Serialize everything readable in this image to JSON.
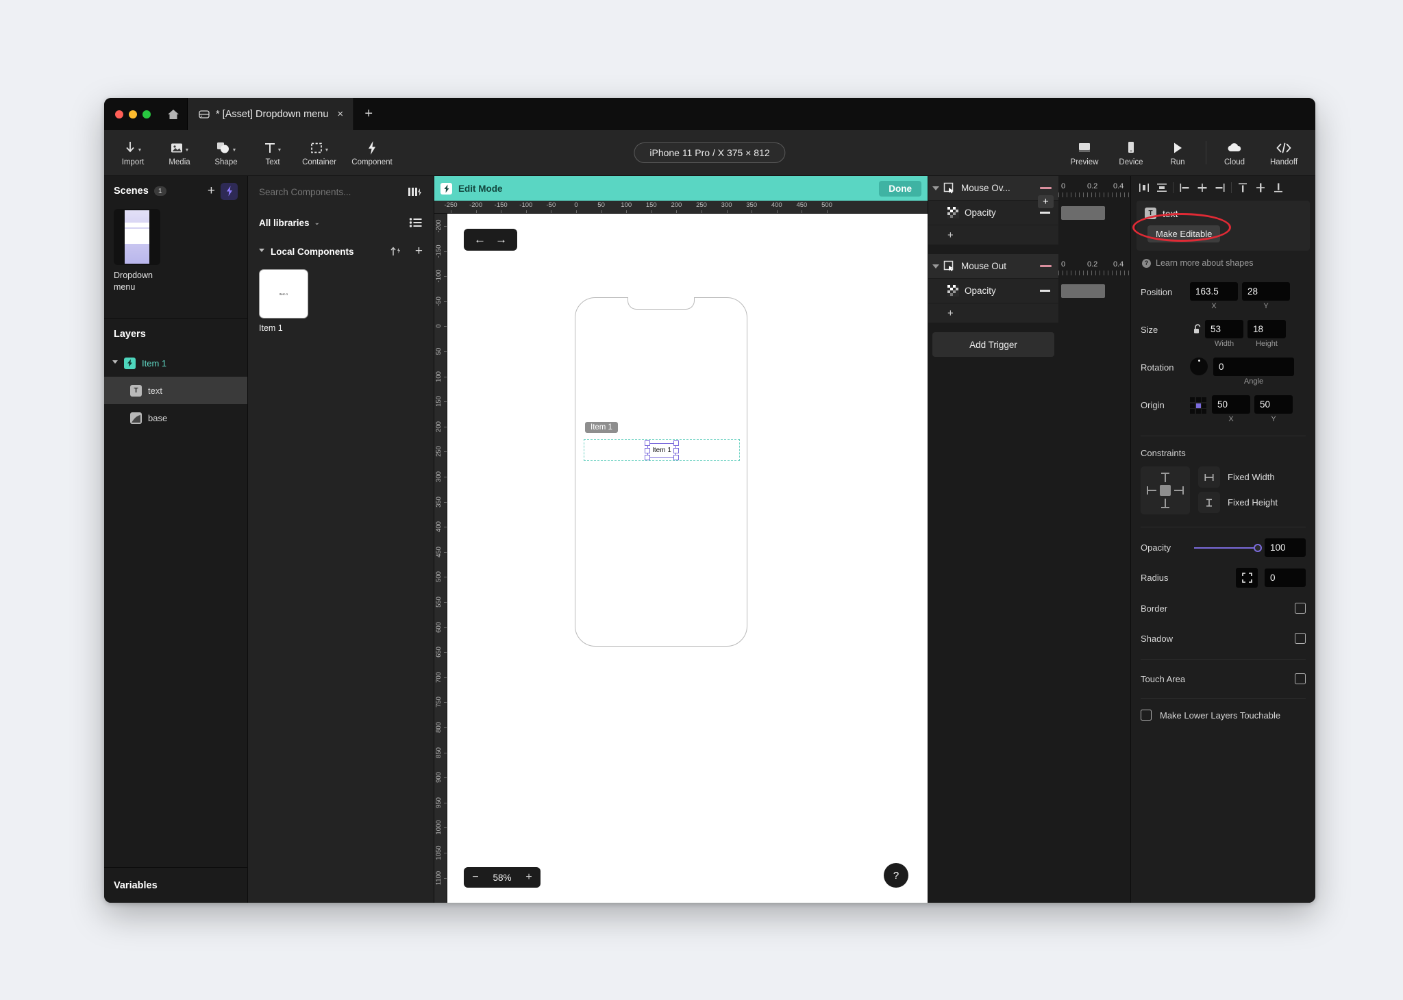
{
  "titlebar": {
    "home_label": "home-button",
    "tab_title": "* [Asset] Dropdown menu",
    "tab_close": "×",
    "new_tab": "+"
  },
  "toolbar": {
    "left_tools": [
      {
        "label": "Import",
        "icon": "download-arrow-icon",
        "has_caret": true
      },
      {
        "label": "Media",
        "icon": "image-icon",
        "has_caret": true
      },
      {
        "label": "Shape",
        "icon": "shape-icon",
        "has_caret": true
      },
      {
        "label": "Text",
        "icon": "text-t-icon",
        "has_caret": true
      },
      {
        "label": "Container",
        "icon": "dashed-square-icon",
        "has_caret": true
      },
      {
        "label": "Component",
        "icon": "lightning-bolt-icon",
        "has_caret": false
      }
    ],
    "device_pill": "iPhone 11 Pro / X  375 × 812",
    "right_tools": [
      {
        "label": "Preview",
        "icon": "monitor-icon"
      },
      {
        "label": "Device",
        "icon": "phone-icon"
      },
      {
        "label": "Run",
        "icon": "play-triangle-icon"
      },
      {
        "label": "Cloud",
        "icon": "cloud-icon"
      },
      {
        "label": "Handoff",
        "icon": "code-brackets-icon"
      }
    ]
  },
  "scenes": {
    "title": "Scenes",
    "count": "1",
    "add_label": "+",
    "items": [
      {
        "name": "Dropdown\nmenu",
        "display_name": "Dropdown menu"
      }
    ]
  },
  "layers": {
    "title": "Layers",
    "items": [
      {
        "label": "Item 1",
        "icon": "component-icon",
        "depth": 0,
        "selected": false,
        "expanded": true
      },
      {
        "label": "text",
        "icon": "text-layer-icon",
        "depth": 1,
        "selected": true
      },
      {
        "label": "base",
        "icon": "shape-layer-icon",
        "depth": 1,
        "selected": false
      }
    ]
  },
  "variables": {
    "title": "Variables"
  },
  "components": {
    "search_placeholder": "Search Components...",
    "libraries_label": "All libraries",
    "section_label": "Local Components",
    "items": [
      {
        "name": "Item 1",
        "thumb_text": "Item 1"
      }
    ]
  },
  "canvas": {
    "edit_mode_label": "Edit Mode",
    "done_label": "Done",
    "zoom_value": "58%",
    "zoom_minus": "−",
    "zoom_plus": "+",
    "nav_back": "←",
    "nav_forward": "→",
    "help_label": "?",
    "selected_badge": "Item 1",
    "selected_text": "Item 1",
    "ruler_h": [
      "-250",
      "-200",
      "-150",
      "-100",
      "-50",
      "0",
      "50",
      "100",
      "150",
      "200",
      "250",
      "300",
      "350",
      "400",
      "450",
      "500"
    ],
    "ruler_v": [
      "-200",
      "-150",
      "-100",
      "-50",
      "0",
      "50",
      "100",
      "150",
      "200",
      "250",
      "300",
      "350",
      "400",
      "450",
      "500",
      "550",
      "600",
      "650",
      "700",
      "750",
      "800",
      "850",
      "900",
      "950",
      "1000",
      "1050",
      "1100"
    ]
  },
  "triggers": {
    "add_trigger_label": "Add Trigger",
    "plus_label": "+",
    "blocks": [
      {
        "name": "Mouse Ov...",
        "full_name": "Mouse Over",
        "icon": "mouse-over-icon",
        "scale": [
          "0",
          "0.2",
          "0.4"
        ],
        "props": [
          {
            "name": "Opacity",
            "icon": "opacity-checker-icon"
          }
        ],
        "add_label": "+"
      },
      {
        "name": "Mouse Out",
        "full_name": "Mouse Out",
        "icon": "mouse-out-icon",
        "scale": [
          "0",
          "0.2",
          "0.4"
        ],
        "props": [
          {
            "name": "Opacity",
            "icon": "opacity-checker-icon"
          }
        ],
        "add_label": "+"
      }
    ]
  },
  "properties": {
    "layer_name": "text",
    "make_editable_label": "Make Editable",
    "learn_more_label": "Learn more about shapes",
    "position": {
      "label": "Position",
      "x": "163.5",
      "y": "28",
      "x_sub": "X",
      "y_sub": "Y"
    },
    "size": {
      "label": "Size",
      "width": "53",
      "height": "18",
      "w_sub": "Width",
      "h_sub": "Height"
    },
    "rotation": {
      "label": "Rotation",
      "angle": "0",
      "sub": "Angle"
    },
    "origin": {
      "label": "Origin",
      "x": "50",
      "y": "50",
      "x_sub": "X",
      "y_sub": "Y"
    },
    "constraints": {
      "label": "Constraints",
      "fixed_width": "Fixed Width",
      "fixed_height": "Fixed Height"
    },
    "opacity": {
      "label": "Opacity",
      "value": "100"
    },
    "radius": {
      "label": "Radius",
      "value": "0"
    },
    "border": {
      "label": "Border"
    },
    "shadow": {
      "label": "Shadow"
    },
    "touch_area": {
      "label": "Touch Area"
    },
    "make_lower": {
      "label": "Make Lower Layers Touchable"
    }
  },
  "colors": {
    "accent_teal": "#5ad6c3",
    "accent_purple": "#7b6bdc",
    "annotation_red": "#e02a35",
    "window_bg": "#1e1e1e"
  }
}
